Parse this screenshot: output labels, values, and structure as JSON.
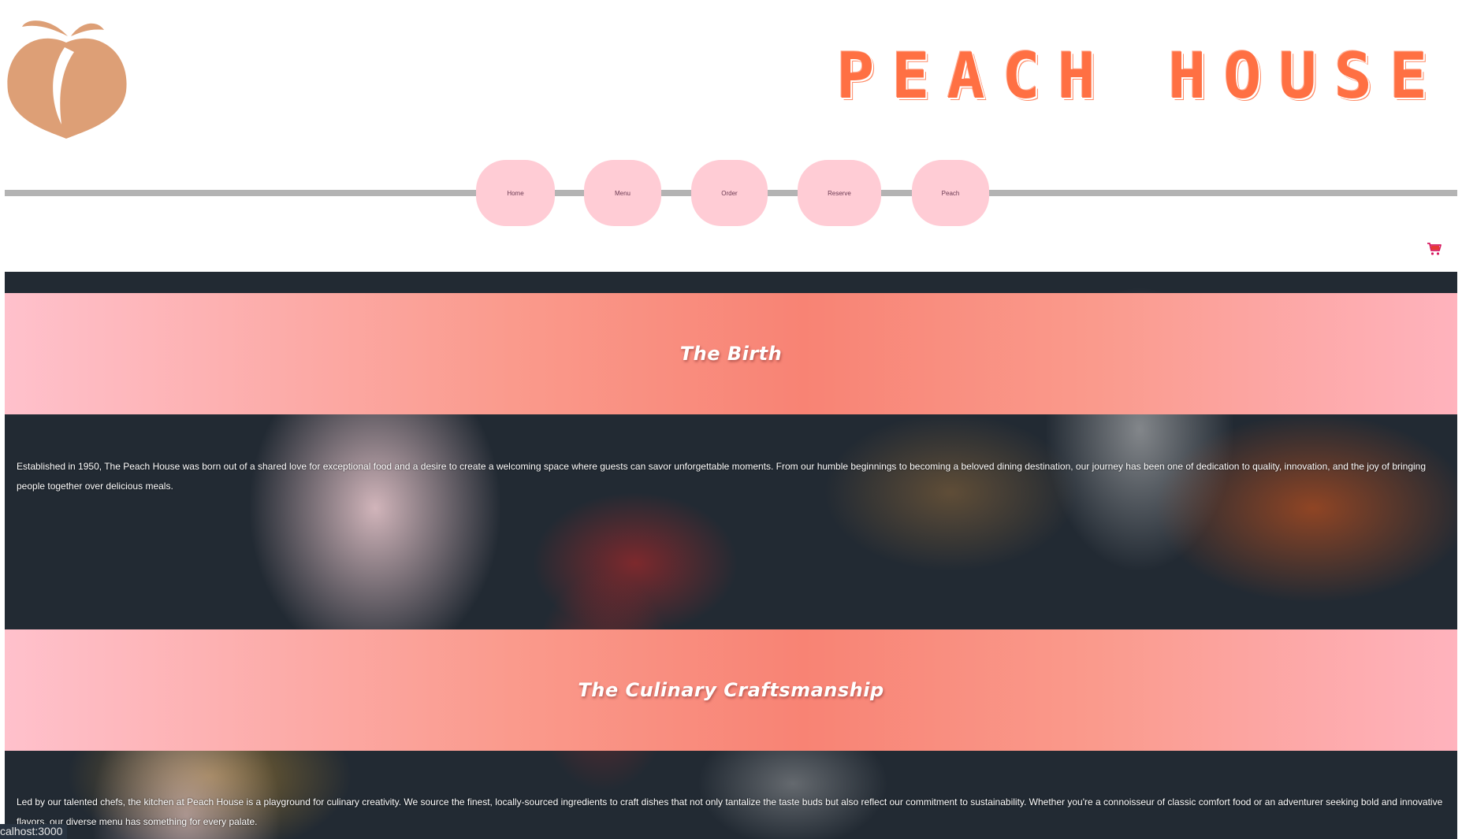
{
  "header": {
    "logo_name": "peach-icon",
    "brand_title": "PEACH HOUSE"
  },
  "nav": {
    "items": [
      {
        "label": "Home"
      },
      {
        "label": "Menu"
      },
      {
        "label": "Order"
      },
      {
        "label": "Reserve"
      },
      {
        "label": "Peach"
      }
    ]
  },
  "cart": {
    "icon": "shopping-cart-icon"
  },
  "sections": [
    {
      "title": "The Birth",
      "text": "Established in 1950, The Peach House was born out of a shared love for exceptional food and a desire to create a welcoming space where guests can savor unforgettable moments. From our humble beginnings to becoming a beloved dining destination, our journey has been one of dedication to quality, innovation, and the joy of bringing people together over delicious meals."
    },
    {
      "title": "The Culinary Craftsmanship",
      "text": "Led by our talented chefs, the kitchen at Peach House is a playground for culinary creativity. We source the finest, locally-sourced ingredients to craft dishes that not only tantalize the taste buds but also reflect our commitment to sustainability. Whether you're a connoisseur of classic comfort food or an adventurer seeking bold and innovative flavors, our diverse menu has something for every palate."
    }
  ],
  "status_bar": {
    "url": "calhost:3000"
  },
  "colors": {
    "brand": "#ff7043",
    "nav_button": "#ffccd5",
    "band_center": "#f88374",
    "band_edge": "#ffc1cc",
    "logo": "#dd9f76"
  }
}
